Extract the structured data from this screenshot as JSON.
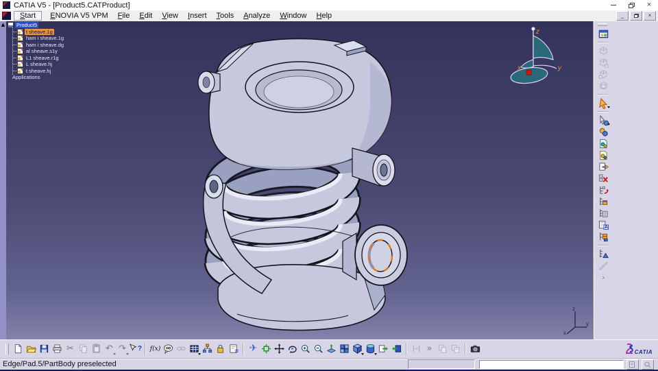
{
  "window": {
    "title": "CATIA V5 - [Product5.CATProduct]"
  },
  "menu_bar": {
    "items": [
      "Start",
      "ENOVIA V5 VPM",
      "File",
      "Edit",
      "View",
      "Insert",
      "Tools",
      "Analyze",
      "Window",
      "Help"
    ]
  },
  "tree": {
    "root": "Product5",
    "items": [
      "t sheave.1g",
      "ham i sheave.1g",
      "ham i sheave.dg",
      "al sheave.s1y",
      "L1 sheave.r1g",
      "L sheave.hj",
      "t sheave.hj"
    ],
    "footer": "Applications"
  },
  "viewport": {
    "compass": {
      "x": "x",
      "y": "y",
      "z": "z"
    },
    "triad": {
      "x": "x",
      "y": "y",
      "z": "z"
    },
    "model": "coil-spring-trunnion-assembly"
  },
  "toolbars": {
    "standard": [
      "new-file",
      "open-folder",
      "save",
      "print",
      "cut",
      "copy",
      "paste",
      "undo",
      "redo",
      "whats-this-help"
    ],
    "knowledge": [
      "formula-fx",
      "knowledge-inspector",
      "link",
      "design-table",
      "knowledge-hierarchy",
      "lock",
      "rules-editor"
    ],
    "view": [
      "fly-mode",
      "fit-all",
      "pan",
      "rotate",
      "zoom-in",
      "zoom-out",
      "normal-view",
      "multi-view",
      "isometric-view",
      "render-style",
      "hide-show",
      "swap-visible-space"
    ],
    "disabled_group": [
      "offset-constraint",
      "more-tools",
      "paste-format-1",
      "paste-format-2"
    ],
    "capture": [
      "camera-snapshot"
    ],
    "right": [
      "product-window",
      "box-tool-1",
      "box-tool-2",
      "box-tool-3",
      "box-tool-4",
      "select",
      "smart-select",
      "update-all",
      "open-part-gears",
      "save-part-gears",
      "insert-component",
      "delete-component",
      "tree-reorder",
      "new-component",
      "selective-load",
      "generate-numbering",
      "manage-representations",
      "graph-tree-reorder",
      "measure",
      "more-chevron"
    ]
  },
  "glyphs": {
    "scroll_up": "▲",
    "cut": "✂",
    "undo": "↶",
    "redo": "↷",
    "help": "?",
    "fx": "f(x)",
    "equals": "=",
    "fly": "✈",
    "more": "»",
    "chevron_small": "›",
    "numbering": "A",
    "close": "×",
    "mdi_min": "_",
    "mdi_close": "×"
  },
  "status_bar": {
    "message": "Edge/Pad.5/PartBody preselected",
    "command_value": ""
  },
  "brand": {
    "name": "CATIA"
  },
  "colors": {
    "viewport_top": "#32325b",
    "viewport_bottom": "#8282ac",
    "model_fill": "#c6c9dd",
    "outline": "#14141c",
    "preselect_orange": "#e2761d",
    "selection_blue": "#2c50c8",
    "tree_highlight_orange": "#e8953a",
    "toolbar_bg": "#d8d5e7",
    "compass_teal": "#2a6a78",
    "compass_label": "#e0912c"
  }
}
